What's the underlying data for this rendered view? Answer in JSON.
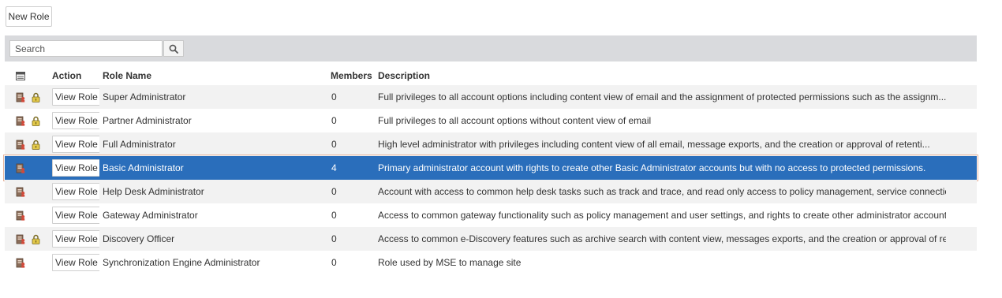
{
  "toolbar": {
    "new_role_label": "New Role"
  },
  "search": {
    "placeholder": "Search",
    "value": ""
  },
  "table": {
    "headers": {
      "action": "Action",
      "role_name": "Role Name",
      "members": "Members",
      "description": "Description"
    },
    "view_label": "View Role",
    "rows": [
      {
        "name": "Super Administrator",
        "members": "0",
        "description": "Full privileges to all account options including content view of email and the assignment of protected permissions such as the assignm...",
        "locked": true,
        "selected": false
      },
      {
        "name": "Partner Administrator",
        "members": "0",
        "description": "Full privileges to all account options without content view of email",
        "locked": true,
        "selected": false
      },
      {
        "name": "Full Administrator",
        "members": "0",
        "description": "High level administrator with privileges including content view of all email, message exports, and the creation or approval of retenti...",
        "locked": true,
        "selected": false
      },
      {
        "name": "Basic Administrator",
        "members": "4",
        "description": "Primary administrator account with rights to create other Basic Administrator accounts but with no access to protected permissions.",
        "locked": false,
        "selected": true
      },
      {
        "name": "Help Desk Administrator",
        "members": "0",
        "description": "Account with access to common help desk tasks such as track and trace, and read only access to policy management, service connections,...",
        "locked": false,
        "selected": false
      },
      {
        "name": "Gateway Administrator",
        "members": "0",
        "description": "Access to common gateway functionality such as policy management and user settings, and rights to create other administrator accounts ...",
        "locked": false,
        "selected": false
      },
      {
        "name": "Discovery Officer",
        "members": "0",
        "description": "Access to common e-Discovery features such as archive search with content view, messages exports, and the creation or approval of rete...",
        "locked": true,
        "selected": false
      },
      {
        "name": "Synchronization Engine Administrator",
        "members": "0",
        "description": "Role used by MSE to manage site",
        "locked": false,
        "selected": false
      }
    ]
  },
  "colors": {
    "selected_row": "#2a6ebb",
    "search_bar": "#d9dadd",
    "stripe": "#f2f2f2"
  }
}
